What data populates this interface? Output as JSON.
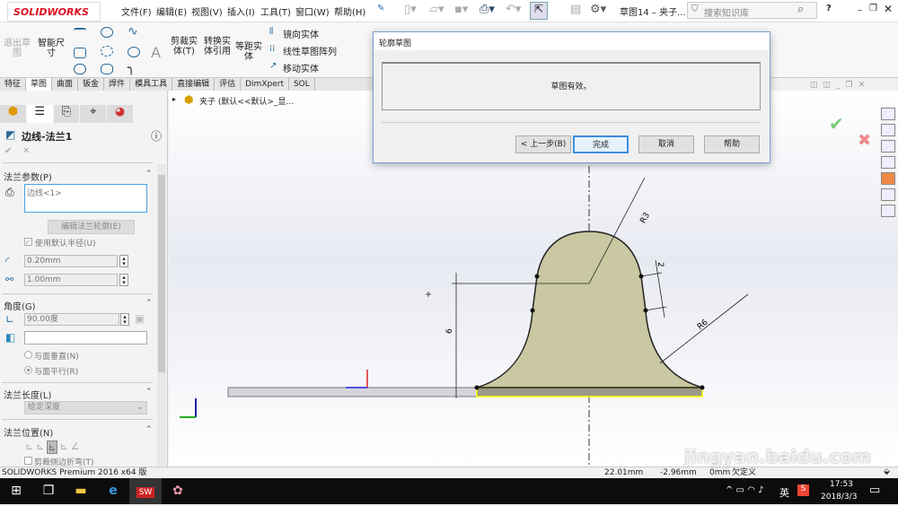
{
  "app": {
    "logo": "SOLIDWORKS",
    "doc_title": "草图14 – 夹子...",
    "search_placeholder": "搜索知识库",
    "help": "?"
  },
  "menu": [
    "文件(F)",
    "编辑(E)",
    "视图(V)",
    "插入(I)",
    "工具(T)",
    "窗口(W)",
    "帮助(H)"
  ],
  "ribbon": {
    "exit_sketch": "退出草图",
    "smart_dim": "智能尺寸",
    "trim": "剪裁实体(T)",
    "convert": "转换实体引用",
    "offset": "等距实体",
    "mirror": "镜向实体",
    "linear_pattern": "线性草图阵列",
    "move": "移动实体"
  },
  "tabs": [
    "特征",
    "草图",
    "曲面",
    "钣金",
    "焊件",
    "模具工具",
    "直接编辑",
    "评估",
    "DimXpert",
    "SOL"
  ],
  "tree": {
    "part": "夹子 (默认<<默认>_显..."
  },
  "panel": {
    "title": "边线-法兰1",
    "flange_params": "法兰参数(P)",
    "edge_sel": "边线<1>",
    "edit_profile": "编辑法兰轮廓(E)",
    "use_default_radius": "使用默认半径(U)",
    "radius": "0.20mm",
    "gap": "1.00mm",
    "angle_section": "角度(G)",
    "angle": "90.00度",
    "normal_to_face": "与面垂直(N)",
    "parallel_to_face": "与面平行(R)",
    "length_section": "法兰长度(L)",
    "end_condition": "给定深度",
    "position_section": "法兰位置(N)",
    "trim_side": "剪裁侧边折弯(T)"
  },
  "dialog": {
    "title": "轮廓草图",
    "message": "草图有效。",
    "back": "< 上一步(B)",
    "finish": "完成",
    "cancel": "取消",
    "help": "帮助"
  },
  "sketch": {
    "dims": [
      "R3",
      "2",
      "6",
      "R6"
    ],
    "fill": "#c9c8a2",
    "highlight": "#ffff00"
  },
  "status": {
    "product": "SOLIDWORKS Premium 2016 x64 版",
    "x": "22.01mm",
    "y": "-2.96mm",
    "z": "0mm",
    "state": "欠定义"
  },
  "taskbar": {
    "ime": "英",
    "time": "17:53",
    "date": "2018/3/3"
  },
  "watermark": "jingyan.baidu.com"
}
